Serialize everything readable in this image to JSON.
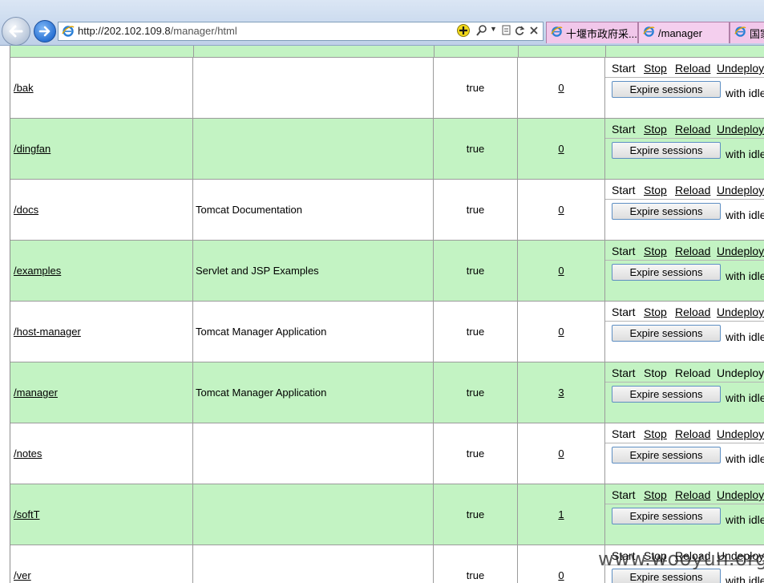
{
  "browser": {
    "url_host": "http://202.102.109.8",
    "url_path": "/manager/html",
    "tabs": [
      {
        "label": "十堰市政府采..."
      },
      {
        "label": "/manager"
      },
      {
        "label": "国家"
      }
    ]
  },
  "commands": {
    "start": "Start",
    "stop": "Stop",
    "reload": "Reload",
    "undeploy": "Undeploy",
    "expire": "Expire sessions",
    "idle": "with idle"
  },
  "apps": [
    {
      "path": "/bak",
      "name": "",
      "running": "true",
      "sessions": "0"
    },
    {
      "path": "/dingfan",
      "name": "",
      "running": "true",
      "sessions": "0"
    },
    {
      "path": "/docs",
      "name": "Tomcat Documentation",
      "running": "true",
      "sessions": "0"
    },
    {
      "path": "/examples",
      "name": "Servlet and JSP Examples",
      "running": "true",
      "sessions": "0"
    },
    {
      "path": "/host-manager",
      "name": "Tomcat Manager Application",
      "running": "true",
      "sessions": "0"
    },
    {
      "path": "/manager",
      "name": "Tomcat Manager Application",
      "running": "true",
      "sessions": "3"
    },
    {
      "path": "/notes",
      "name": "",
      "running": "true",
      "sessions": "0"
    },
    {
      "path": "/softT",
      "name": "",
      "running": "true",
      "sessions": "1"
    },
    {
      "path": "/ver",
      "name": "",
      "running": "true",
      "sessions": "0"
    }
  ],
  "watermark": "www.wooyun.org",
  "colors": {
    "row_alt": "#c3f3c3",
    "row": "#ffffff"
  }
}
